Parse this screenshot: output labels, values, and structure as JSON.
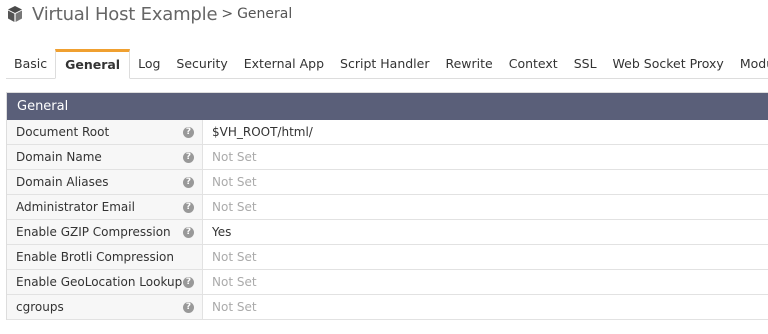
{
  "header": {
    "title": "Virtual Host Example",
    "separator": ">",
    "subtitle": "General",
    "icon": "cube-icon"
  },
  "tabs": [
    {
      "label": "Basic",
      "active": false
    },
    {
      "label": "General",
      "active": true
    },
    {
      "label": "Log",
      "active": false
    },
    {
      "label": "Security",
      "active": false
    },
    {
      "label": "External App",
      "active": false
    },
    {
      "label": "Script Handler",
      "active": false
    },
    {
      "label": "Rewrite",
      "active": false
    },
    {
      "label": "Context",
      "active": false
    },
    {
      "label": "SSL",
      "active": false
    },
    {
      "label": "Web Socket Proxy",
      "active": false
    },
    {
      "label": "Modules",
      "active": false
    }
  ],
  "panel": {
    "title": "General",
    "header_color": "#5a5f79",
    "rows": [
      {
        "label": "Document Root",
        "value": "$VH_ROOT/html/",
        "help": true,
        "is_set": true
      },
      {
        "label": "Domain Name",
        "value": "Not Set",
        "help": true,
        "is_set": false
      },
      {
        "label": "Domain Aliases",
        "value": "Not Set",
        "help": true,
        "is_set": false
      },
      {
        "label": "Administrator Email",
        "value": "Not Set",
        "help": true,
        "is_set": false
      },
      {
        "label": "Enable GZIP Compression",
        "value": "Yes",
        "help": true,
        "is_set": true
      },
      {
        "label": "Enable Brotli Compression",
        "value": "Not Set",
        "help": false,
        "is_set": false
      },
      {
        "label": "Enable GeoLocation Lookup",
        "value": "Not Set",
        "help": true,
        "is_set": false
      },
      {
        "label": "cgroups",
        "value": "Not Set",
        "help": true,
        "is_set": false
      }
    ]
  },
  "colors": {
    "active_tab_accent": "#f0a030",
    "not_set_text": "#aaaaaa"
  }
}
